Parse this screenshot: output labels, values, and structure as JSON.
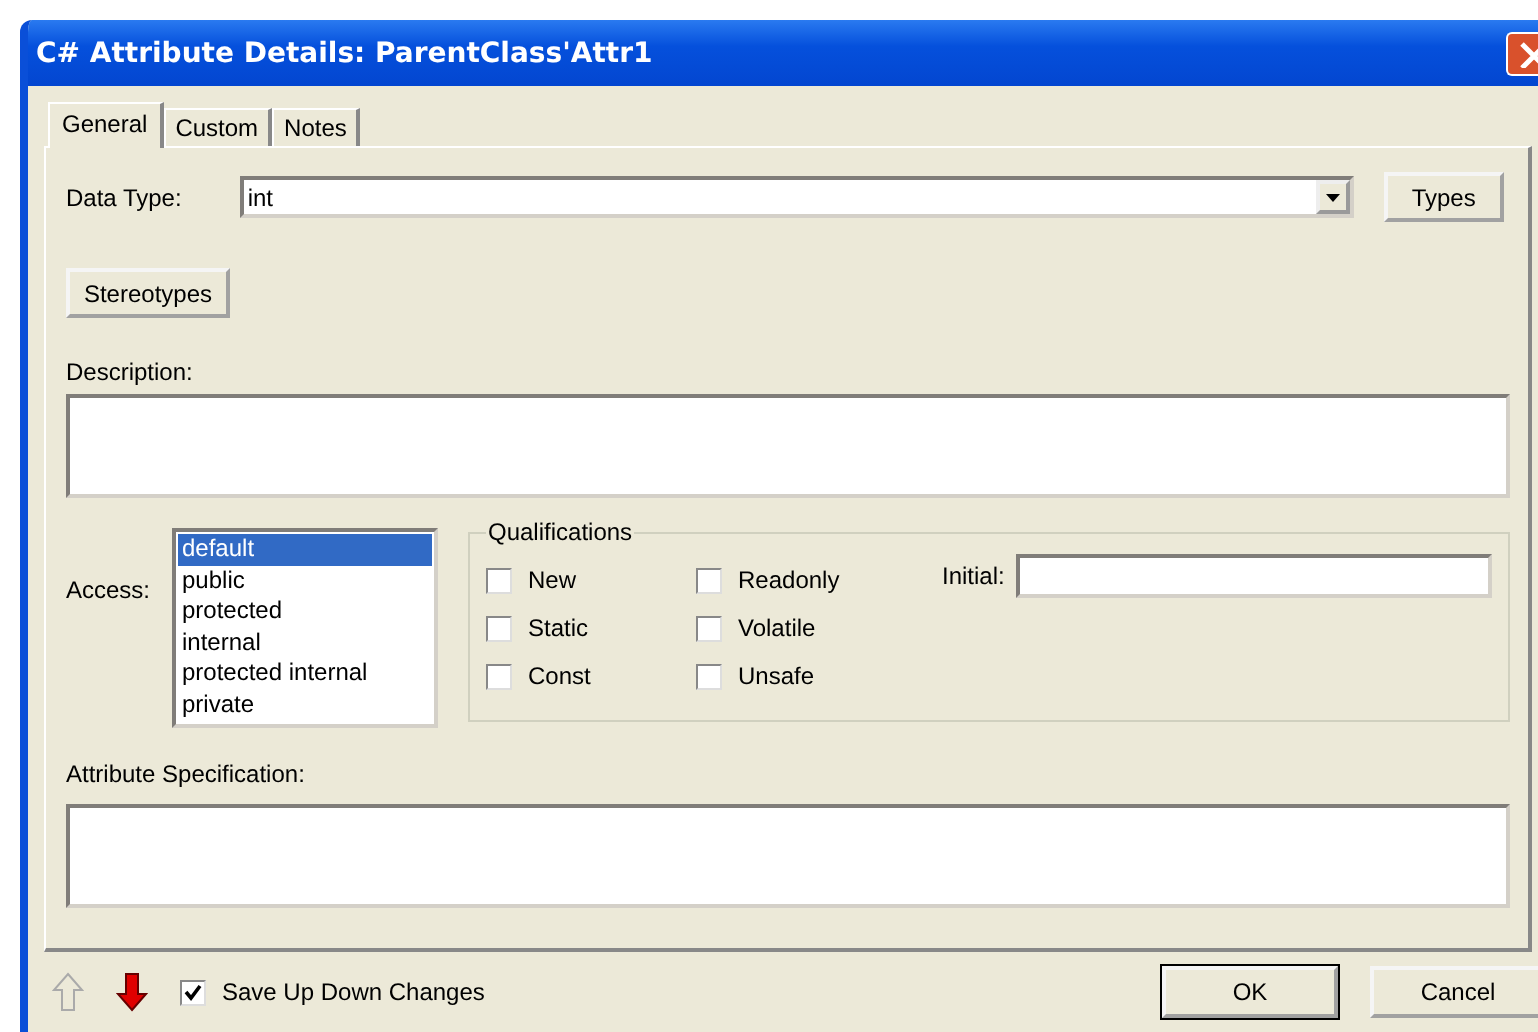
{
  "window": {
    "title": "C# Attribute Details: ParentClass'Attr1"
  },
  "tabs": [
    {
      "label": "General",
      "selected": true
    },
    {
      "label": "Custom",
      "selected": false
    },
    {
      "label": "Notes",
      "selected": false
    }
  ],
  "data_type": {
    "label": "Data Type:",
    "value": "int",
    "button": "Types"
  },
  "stereotypes_button": "Stereotypes",
  "description": {
    "label": "Description:"
  },
  "access": {
    "label": "Access:",
    "items": [
      {
        "label": "default",
        "selected": true
      },
      {
        "label": "public",
        "selected": false
      },
      {
        "label": "protected",
        "selected": false
      },
      {
        "label": "internal",
        "selected": false
      },
      {
        "label": "protected internal",
        "selected": false
      },
      {
        "label": "private",
        "selected": false
      }
    ]
  },
  "qualifications": {
    "title": "Qualifications",
    "options": [
      {
        "label": "New",
        "checked": false
      },
      {
        "label": "Static",
        "checked": false
      },
      {
        "label": "Const",
        "checked": false
      },
      {
        "label": "Readonly",
        "checked": false
      },
      {
        "label": "Volatile",
        "checked": false
      },
      {
        "label": "Unsafe",
        "checked": false
      }
    ],
    "initial_label": "Initial:"
  },
  "attribute_specification": {
    "label": "Attribute Specification:"
  },
  "footer": {
    "move_up": {
      "enabled": false
    },
    "move_down": {
      "enabled": true
    },
    "save_changes": {
      "label": "Save Up Down Changes",
      "checked": true
    },
    "buttons": [
      "OK",
      "Cancel"
    ]
  }
}
